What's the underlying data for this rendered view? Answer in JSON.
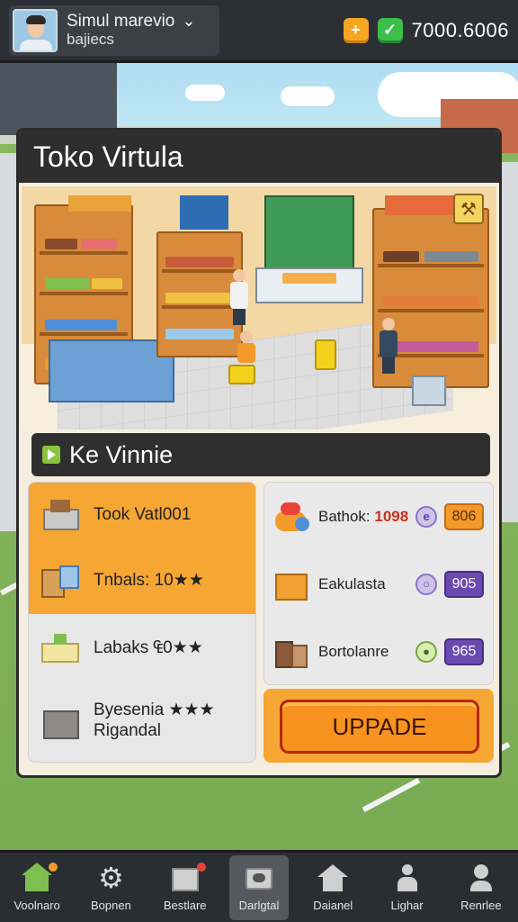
{
  "topbar": {
    "profile_name": "Simul marevio",
    "profile_sub": "bajiecs",
    "coin_icon": "plus-coin-icon",
    "gem_icon": "check-icon",
    "money": "7000.6006"
  },
  "panel": {
    "title": "Toko Virtula",
    "section_title": "Ke Vinnie",
    "left_items": [
      {
        "label": "Took Vatl001",
        "icon": "cash-register-icon",
        "highlight": true
      },
      {
        "label": "Tnbals: 10★★",
        "icon": "boxes-icon",
        "highlight": true
      },
      {
        "label": "Labaks ₠0★★",
        "icon": "cheese-icon",
        "highlight": false
      },
      {
        "label": "Byesenia ★★★",
        "label2": "Rigandal",
        "icon": "storage-box-icon",
        "highlight": false
      }
    ],
    "right_items": [
      {
        "label": "Bathok:",
        "value": "1098",
        "circle": "e",
        "pill": "806",
        "pill_color": "orange",
        "icon": "food-pile-icon"
      },
      {
        "label": "Eakulasta",
        "circle": "○",
        "pill": "905",
        "pill_color": "purple",
        "icon": "orange-box-icon"
      },
      {
        "label": "Bortolanre",
        "circle": "●",
        "pill": "965",
        "pill_color": "purple",
        "icon": "crates-icon"
      }
    ],
    "upgrade_label": "UPPADE"
  },
  "nav": [
    {
      "label": "Voolnaro",
      "icon": "home-icon",
      "badge": "orange"
    },
    {
      "label": "Bopnen",
      "icon": "gear-icon"
    },
    {
      "label": "Bestlare",
      "icon": "shop-box-icon",
      "badge": "red"
    },
    {
      "label": "Darlgtal",
      "icon": "register-icon",
      "active": true
    },
    {
      "label": "Daianel",
      "icon": "house-icon"
    },
    {
      "label": "Lighar",
      "icon": "person-icon"
    },
    {
      "label": "Renrlee",
      "icon": "user-icon"
    }
  ]
}
